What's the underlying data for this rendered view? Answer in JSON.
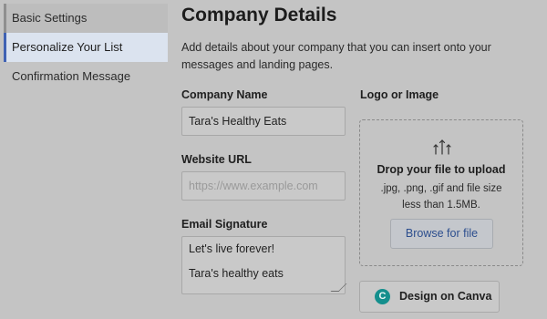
{
  "sidebar": {
    "items": [
      {
        "label": "Basic Settings"
      },
      {
        "label": "Personalize Your List"
      },
      {
        "label": "Confirmation Message"
      }
    ]
  },
  "main": {
    "title": "Company Details",
    "description": "Add details about your company that you can insert onto your messages and landing pages."
  },
  "form": {
    "company_name": {
      "label": "Company Name",
      "value": "Tara's Healthy Eats"
    },
    "website_url": {
      "label": "Website URL",
      "value": "",
      "placeholder": "https://www.example.com"
    },
    "email_signature": {
      "label": "Email Signature",
      "line1": "Let's live forever!",
      "line2": "Tara's healthy eats"
    }
  },
  "logo": {
    "label": "Logo or Image",
    "icon": "upload-arrows-icon",
    "drop_title": "Drop your file to upload",
    "drop_sub": ".jpg, .png, .gif and file size less than 1.5MB.",
    "browse_label": "Browse for file",
    "canva_label": "Design on Canva",
    "canva_icon": "C"
  },
  "colors": {
    "overlay": "#c4c4c4",
    "active_accent": "#3f62b3",
    "link": "#2c4e8e",
    "canva": "#148f8d"
  }
}
